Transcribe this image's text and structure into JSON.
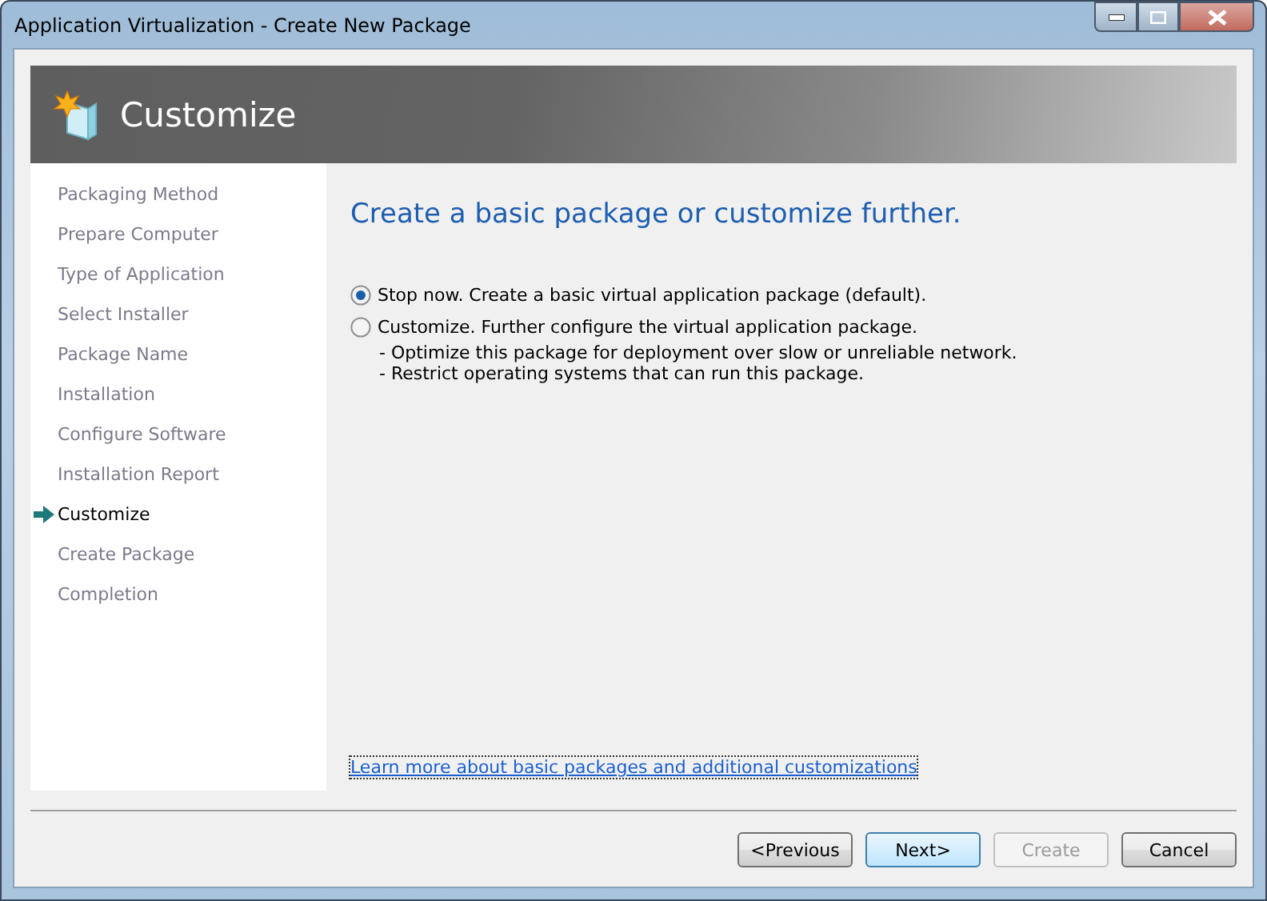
{
  "window": {
    "title": "Application Virtualization - Create New Package"
  },
  "header": {
    "title": "Customize"
  },
  "steps": [
    {
      "label": "Packaging Method",
      "selected": false
    },
    {
      "label": "Prepare Computer",
      "selected": false
    },
    {
      "label": "Type of Application",
      "selected": false
    },
    {
      "label": "Select Installer",
      "selected": false
    },
    {
      "label": "Package Name",
      "selected": false
    },
    {
      "label": "Installation",
      "selected": false
    },
    {
      "label": "Configure Software",
      "selected": false
    },
    {
      "label": "Installation Report",
      "selected": false
    },
    {
      "label": "Customize",
      "selected": true
    },
    {
      "label": "Create Package",
      "selected": false
    },
    {
      "label": "Completion",
      "selected": false
    }
  ],
  "heading": "Create a basic package or customize further.",
  "options": [
    {
      "label": "Stop now.  Create a basic virtual application package (default).",
      "checked": true
    },
    {
      "label": "Customize.  Further configure the virtual application package.",
      "checked": false,
      "details": [
        "- Optimize this package for deployment over slow or unreliable network.",
        "- Restrict operating systems that can run this package."
      ]
    }
  ],
  "link": "Learn more about basic packages and additional customizations",
  "buttons": [
    {
      "label": "<Previous",
      "disabled": false,
      "default": false
    },
    {
      "label": "Next>",
      "disabled": false,
      "default": true
    },
    {
      "label": "Create",
      "disabled": true,
      "default": false
    },
    {
      "label": "Cancel",
      "disabled": false,
      "default": false
    }
  ]
}
